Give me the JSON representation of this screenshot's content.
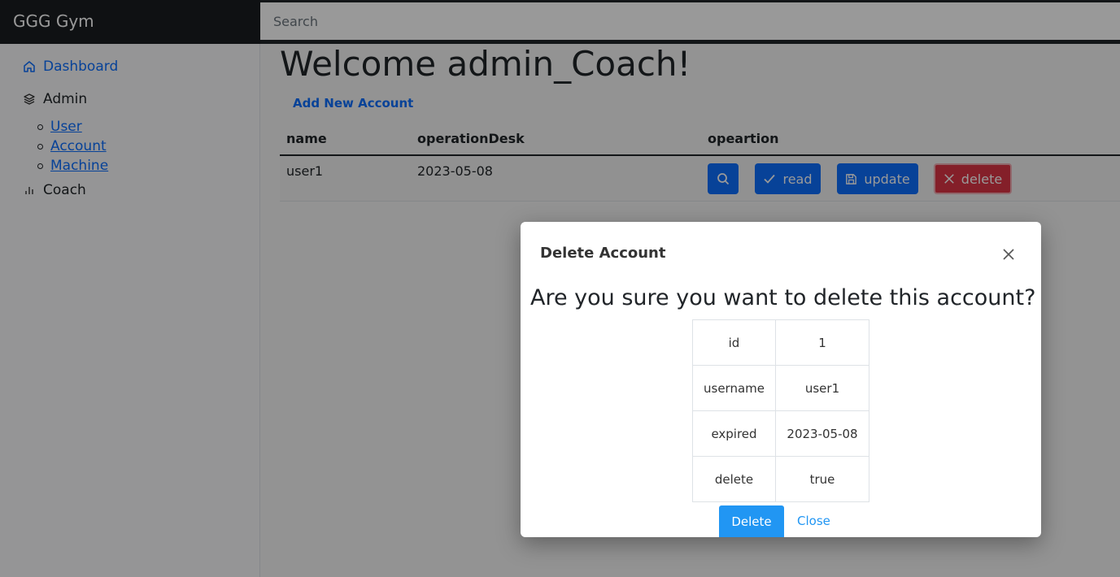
{
  "brand": "GGG Gym",
  "search": {
    "placeholder": "Search"
  },
  "sidebar": {
    "dashboard": "Dashboard",
    "admin": "Admin",
    "admin_items": [
      "User",
      "Account",
      "Machine"
    ],
    "coach": "Coach"
  },
  "main": {
    "welcome": "Welcome admin_Coach!",
    "add_link": "Add New Account",
    "table": {
      "headers": [
        "name",
        "operationDesk",
        "opeartion"
      ],
      "rows": [
        {
          "name": "user1",
          "date": "2023-05-08"
        }
      ],
      "actions": {
        "read": "read",
        "update": "update",
        "delete": "delete"
      }
    }
  },
  "modal": {
    "title": "Delete Account",
    "question": "Are you sure you want to delete this account?",
    "fields": [
      {
        "key": "id",
        "value": "1"
      },
      {
        "key": "username",
        "value": "user1"
      },
      {
        "key": "expired",
        "value": "2023-05-08"
      },
      {
        "key": "delete",
        "value": "true"
      }
    ],
    "delete_button": "Delete",
    "close_button": "Close"
  },
  "colors": {
    "primary": "#0d6efd",
    "danger": "#dc3545",
    "modal_button": "#2196f3",
    "topbar": "#212529"
  }
}
